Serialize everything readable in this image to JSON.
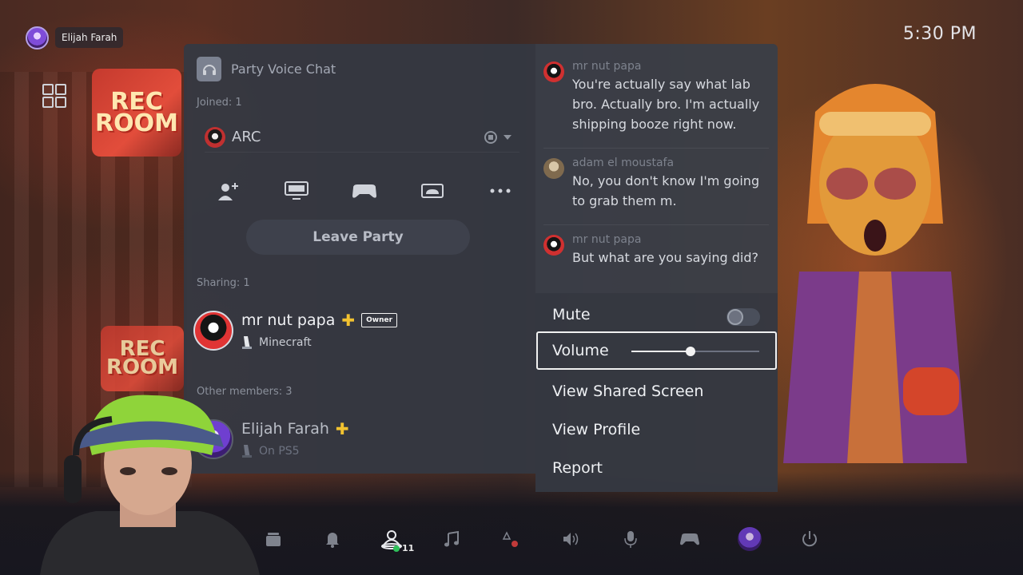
{
  "status_bar": {
    "user_name": "Elijah Farah",
    "clock": "5:30 PM"
  },
  "game_art": {
    "tile_logo": "REC ROOM",
    "tile_logo_2": "REC ROOM"
  },
  "party": {
    "title": "Party Voice Chat",
    "joined_label": "Joined: 1",
    "joined_member": "ARC",
    "actions": [
      "add-friend-icon",
      "share-screen-icon",
      "share-play-icon",
      "game-base-icon",
      "more-icon"
    ],
    "leave_label": "Leave Party",
    "sharing_label": "Sharing: 1",
    "sharing_member": {
      "name": "mr nut papa",
      "badge": "Owner",
      "status": "Minecraft"
    },
    "other_label": "Other members: 3",
    "other_member": {
      "name": "Elijah Farah",
      "status": "On PS5"
    }
  },
  "chat": {
    "messages": [
      {
        "author": "mr nut papa",
        "text": "You're actually say what lab bro. Actually bro. I'm actually shipping booze right now."
      },
      {
        "author": "adam el moustafa",
        "text": "No, you don't know I'm going to grab them m."
      },
      {
        "author": "mr nut papa",
        "text": "But what are you saying did?"
      }
    ]
  },
  "menu": {
    "mute_label": "Mute",
    "mute_on": false,
    "volume_label": "Volume",
    "volume_level": 0.46,
    "view_shared_label": "View Shared Screen",
    "view_profile_label": "View Profile",
    "report_label": "Report"
  },
  "control_center": {
    "items": [
      "home-icon",
      "notifications-icon",
      "game-base-icon",
      "music-icon",
      "accessibility-icon",
      "sound-icon",
      "mic-icon",
      "controller-icon",
      "profile-icon",
      "power-icon"
    ],
    "friends_online": "11"
  },
  "colors": {
    "ps_plus": "#f2c230",
    "online": "#2fc05a",
    "panel": "#343842"
  }
}
